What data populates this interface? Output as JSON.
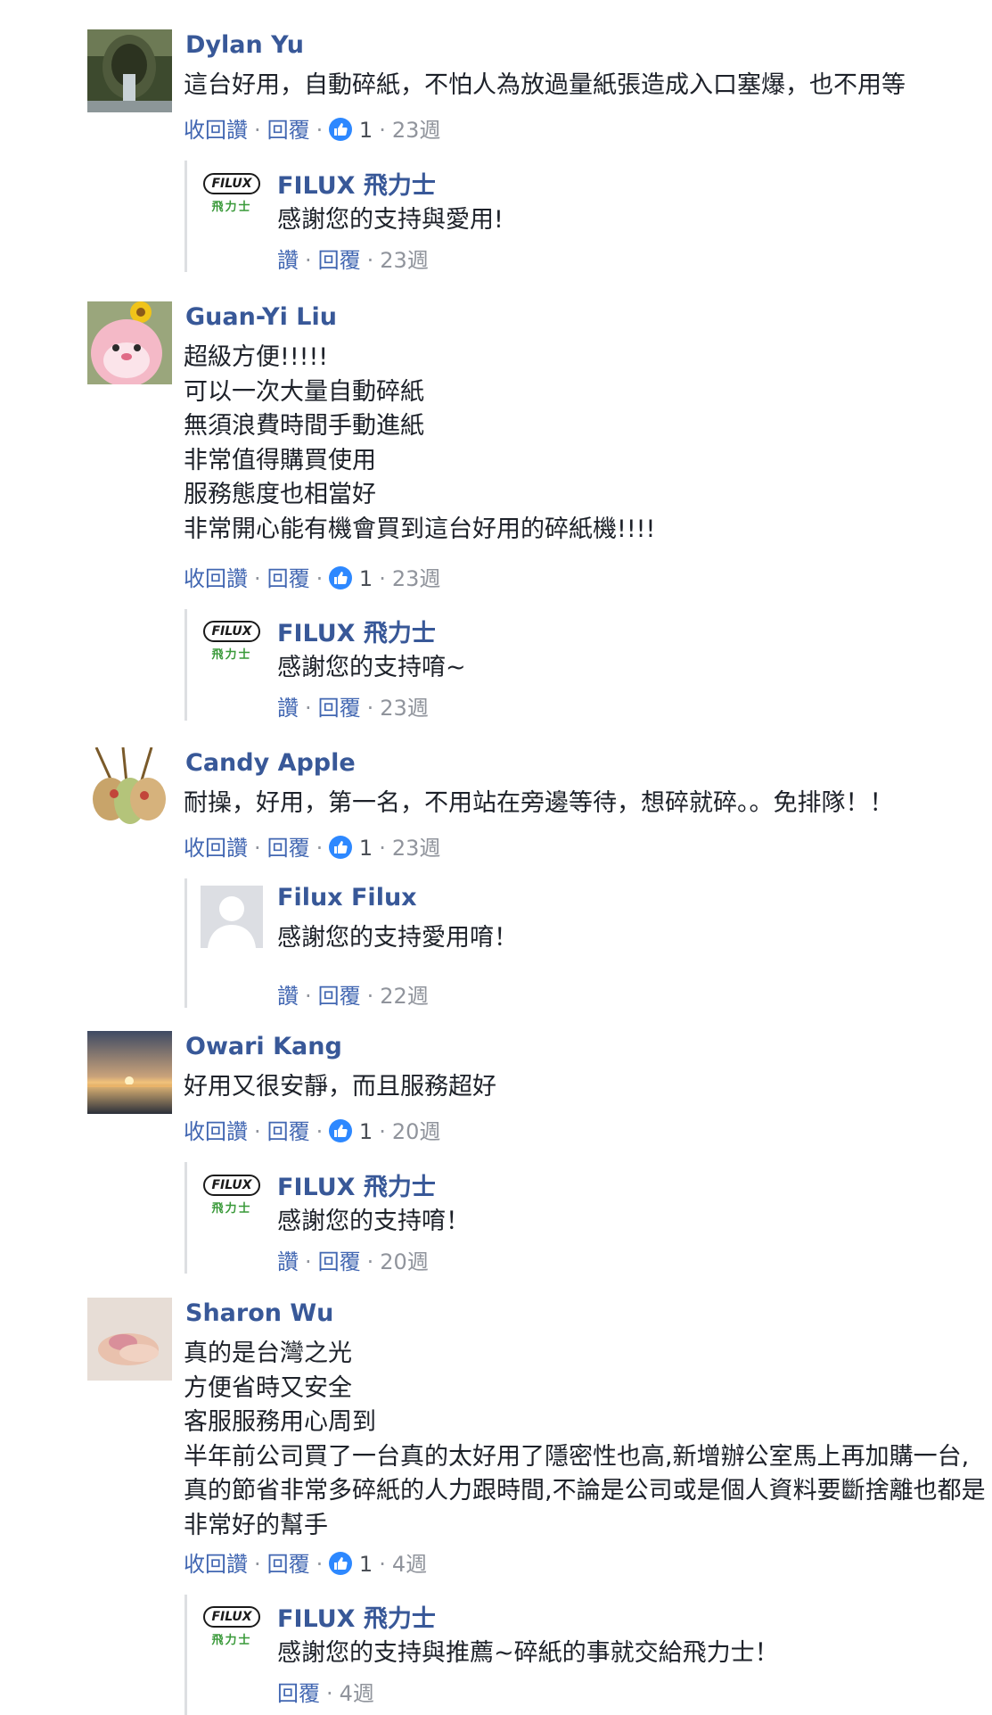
{
  "actions": {
    "unlike": "收回讚",
    "like": "讚",
    "reply": "回覆",
    "sep": "·"
  },
  "colors": {
    "name": "#385898",
    "link": "#4267b2",
    "muted": "#90949c",
    "like_badge": "#2d88ff",
    "logo_green": "#3a9a3a"
  },
  "threads": [
    {
      "comment": {
        "author": "Dylan Yu",
        "avatar": "stone-statue-avatar",
        "lines": [
          "這台好用，自動碎紙，不怕人為放過量紙張造成入口塞爆，也不用等"
        ],
        "likes": "1",
        "time": "23週"
      },
      "reply": {
        "author": "FILUX 飛力士",
        "avatar": "filux-logo",
        "logo_text": "FILUX",
        "logo_sub": "飛力士",
        "text": "感謝您的支持與愛用!",
        "time": "23週"
      }
    },
    {
      "comment": {
        "author": "Guan-Yi Liu",
        "avatar": "pink-toy-avatar",
        "lines": [
          "超級方便!!!!!",
          "可以一次大量自動碎紙",
          "無須浪費時間手動進紙",
          "非常值得購買使用",
          "服務態度也相當好",
          "非常開心能有機會買到這台好用的碎紙機!!!!"
        ],
        "likes": "1",
        "time": "23週"
      },
      "reply": {
        "author": "FILUX 飛力士",
        "avatar": "filux-logo",
        "logo_text": "FILUX",
        "logo_sub": "飛力士",
        "text": "感謝您的支持唷~",
        "time": "23週"
      }
    },
    {
      "comment": {
        "author": "Candy Apple",
        "avatar": "food-skewers-avatar",
        "lines": [
          "耐操，好用，第一名，不用站在旁邊等待，想碎就碎。。免排隊！！"
        ],
        "likes": "1",
        "time": "23週"
      },
      "reply": {
        "author": "Filux Filux",
        "avatar": "default-user-avatar",
        "text": "感謝您的支持愛用唷！",
        "time": "22週"
      }
    },
    {
      "comment": {
        "author": "Owari Kang",
        "avatar": "sunset-avatar",
        "lines": [
          "好用又很安靜，而且服務超好"
        ],
        "likes": "1",
        "time": "20週"
      },
      "reply": {
        "author": "FILUX 飛力士",
        "avatar": "filux-logo",
        "logo_text": "FILUX",
        "logo_sub": "飛力士",
        "text": "感謝您的支持唷！",
        "time": "20週"
      }
    },
    {
      "comment": {
        "author": "Sharon Wu",
        "avatar": "hands-avatar",
        "lines": [
          "真的是台灣之光",
          "方便省時又安全",
          "客服服務用心周到",
          "半年前公司買了一台真的太好用了隱密性也高,新增辦公室馬上再加購一台,真的節省非常多碎紙的人力跟時間,不論是公司或是個人資料要斷捨離也都是非常好的幫手"
        ],
        "likes": "1",
        "time": "4週"
      },
      "reply": {
        "author": "FILUX 飛力士",
        "avatar": "filux-logo",
        "logo_text": "FILUX",
        "logo_sub": "飛力士",
        "text": "感謝您的支持與推薦~碎紙的事就交給飛力士！",
        "time": "4週"
      }
    }
  ]
}
